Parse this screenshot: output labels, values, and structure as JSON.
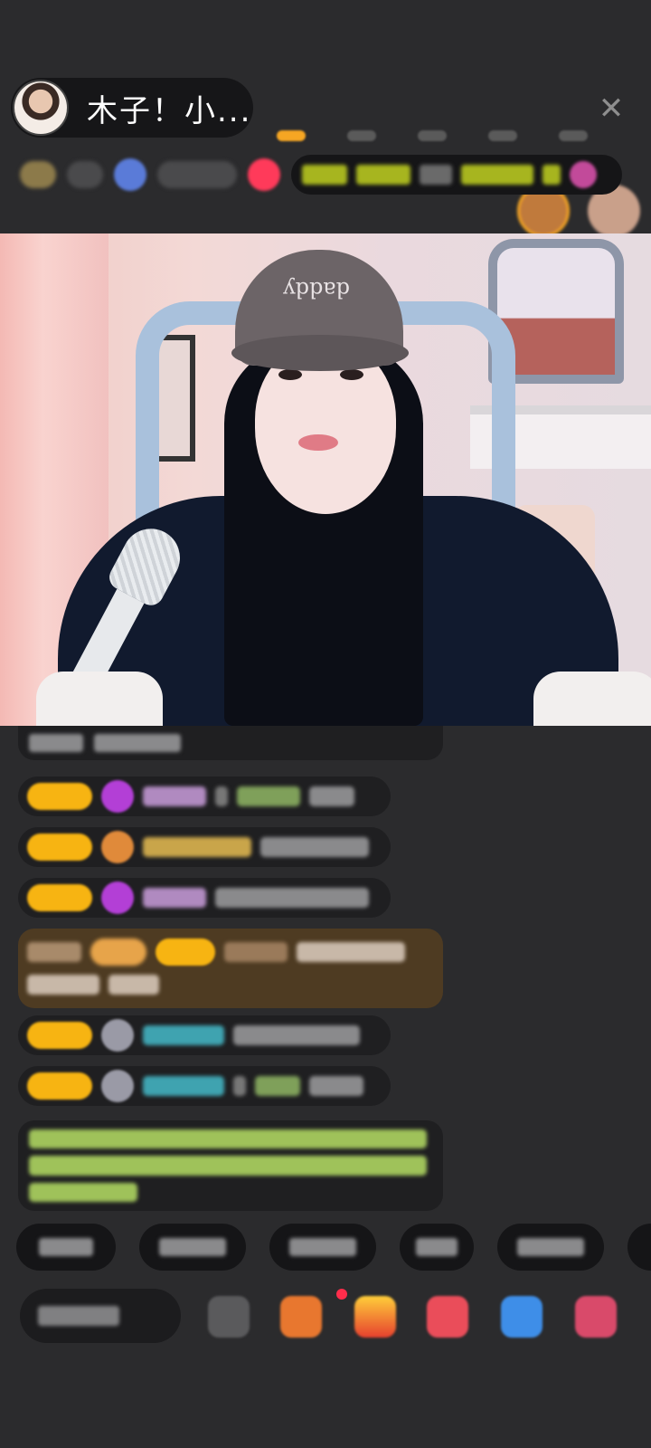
{
  "host": {
    "name": "木子！小...",
    "avatar": "host-avatar"
  },
  "header": {
    "close_icon": "✕",
    "viewers": [
      {
        "icon": "viewer-avatar",
        "rank": "gold",
        "color": "#c07a3c"
      },
      {
        "icon": "viewer-avatar",
        "rank": "normal",
        "color": "#c9a08a"
      },
      {
        "icon": "viewer-avatar",
        "rank": "normal",
        "color": "#d9d3cf"
      },
      {
        "icon": "viewer-avatar",
        "rank": "normal",
        "color": "#b58a6a"
      },
      {
        "icon": "viewer-avatar",
        "rank": "normal",
        "color": "#d7b6b6"
      }
    ]
  },
  "stream": {
    "cap_logo": "daddy"
  },
  "colors": {
    "background": "#2b2b2d",
    "badge": "#f7b412",
    "gift_bg": "#4e3b22",
    "system_text": "#9fc25a",
    "accent_pink": "#ff2d4b"
  },
  "toolbar": {
    "icons": [
      "emoji-icon",
      "gift-box-icon",
      "treasure-chest-icon",
      "pk-icon",
      "game-icon",
      "more-apps-icon"
    ]
  }
}
